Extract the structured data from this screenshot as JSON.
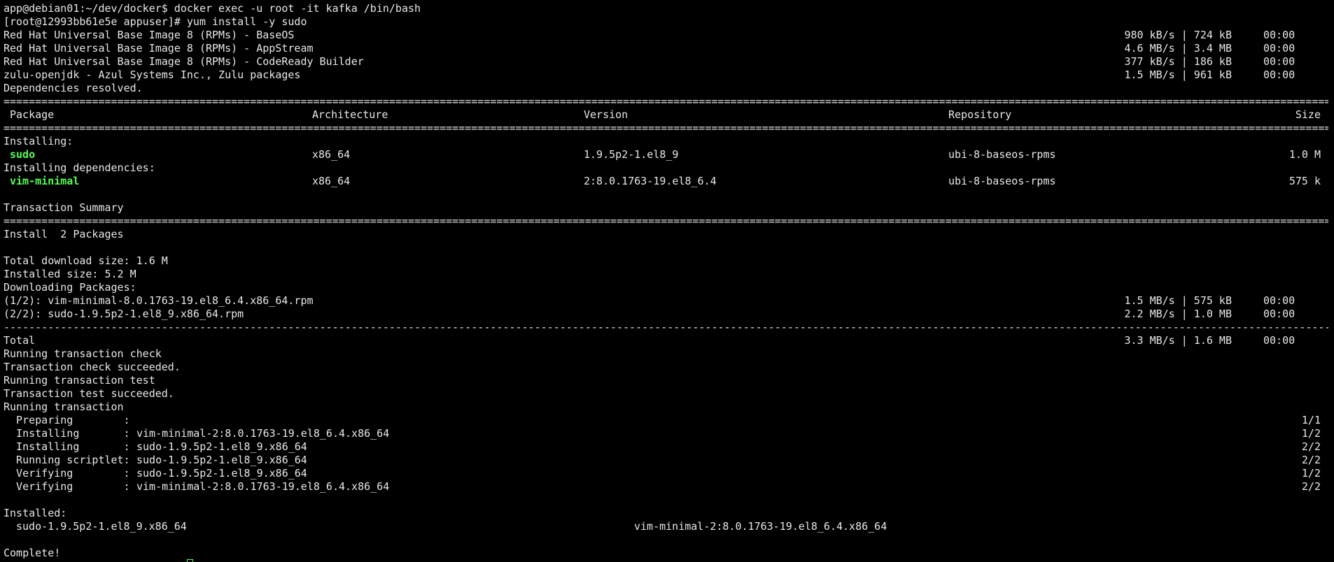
{
  "colors": {
    "background": "#000000",
    "text": "#e8e8e8",
    "highlight": "#55ff55"
  },
  "prompt_line": "app@debian01:~/dev/docker$ docker exec -u root -it kafka /bin/bash",
  "command_line": "[root@12993bb61e5e appuser]# yum install -y sudo",
  "repos": [
    {
      "name": "Red Hat Universal Base Image 8 (RPMs) - BaseOS",
      "speed": "980 kB/s | 724 kB",
      "time": "00:00"
    },
    {
      "name": "Red Hat Universal Base Image 8 (RPMs) - AppStream",
      "speed": "4.6 MB/s | 3.4 MB",
      "time": "00:00"
    },
    {
      "name": "Red Hat Universal Base Image 8 (RPMs) - CodeReady Builder",
      "speed": "377 kB/s | 186 kB",
      "time": "00:00"
    },
    {
      "name": "zulu-openjdk - Azul Systems Inc., Zulu packages",
      "speed": "1.5 MB/s | 961 kB",
      "time": "00:00"
    }
  ],
  "deps_resolved": "Dependencies resolved.",
  "double_rule": "==============================================================================================================================================================================================================================================================================",
  "single_rule": "------------------------------------------------------------------------------------------------------------------------------------------------------------------------------------------------------------------------------------------------------------------------------",
  "table_headers": {
    "package": "Package",
    "arch": "Architecture",
    "version": "Version",
    "repo": "Repository",
    "size": "Size"
  },
  "installing_label": "Installing:",
  "installing_deps_label": "Installing dependencies:",
  "packages": [
    {
      "name": "sudo",
      "arch": "x86_64",
      "version": "1.9.5p2-1.el8_9",
      "repo": "ubi-8-baseos-rpms",
      "size": "1.0 M"
    },
    {
      "name": "vim-minimal",
      "arch": "x86_64",
      "version": "2:8.0.1763-19.el8_6.4",
      "repo": "ubi-8-baseos-rpms",
      "size": "575 k"
    }
  ],
  "transaction_summary": "Transaction Summary",
  "install_count": "Install  2 Packages",
  "total_download": "Total download size: 1.6 M",
  "installed_size": "Installed size: 5.2 M",
  "downloading": "Downloading Packages:",
  "downloads": [
    {
      "file": "(1/2): vim-minimal-8.0.1763-19.el8_6.4.x86_64.rpm",
      "speed": "1.5 MB/s | 575 kB",
      "time": "00:00"
    },
    {
      "file": "(2/2): sudo-1.9.5p2-1.el8_9.x86_64.rpm",
      "speed": "2.2 MB/s | 1.0 MB",
      "time": "00:00"
    }
  ],
  "total": {
    "label": "Total",
    "speed": "3.3 MB/s | 1.6 MB",
    "time": "00:00"
  },
  "checks": [
    "Running transaction check",
    "Transaction check succeeded.",
    "Running transaction test",
    "Transaction test succeeded.",
    "Running transaction"
  ],
  "steps": [
    {
      "action": "  Preparing        :",
      "target": "",
      "count": "1/1"
    },
    {
      "action": "  Installing       :",
      "target": "vim-minimal-2:8.0.1763-19.el8_6.4.x86_64",
      "count": "1/2"
    },
    {
      "action": "  Installing       :",
      "target": "sudo-1.9.5p2-1.el8_9.x86_64",
      "count": "2/2"
    },
    {
      "action": "  Running scriptlet:",
      "target": "sudo-1.9.5p2-1.el8_9.x86_64",
      "count": "2/2"
    },
    {
      "action": "  Verifying        :",
      "target": "sudo-1.9.5p2-1.el8_9.x86_64",
      "count": "1/2"
    },
    {
      "action": "  Verifying        :",
      "target": "vim-minimal-2:8.0.1763-19.el8_6.4.x86_64",
      "count": "2/2"
    }
  ],
  "installed_label": "Installed:",
  "installed_items": [
    "sudo-1.9.5p2-1.el8_9.x86_64",
    "vim-minimal-2:8.0.1763-19.el8_6.4.x86_64"
  ],
  "complete": "Complete!"
}
